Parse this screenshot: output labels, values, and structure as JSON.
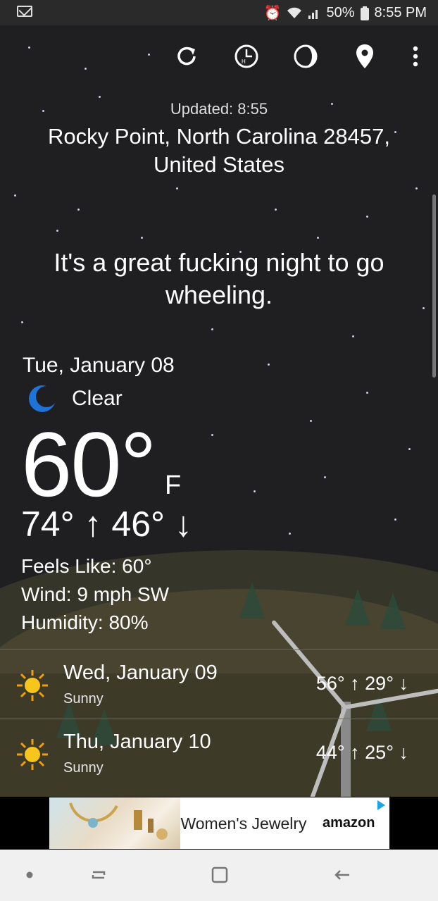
{
  "status_bar": {
    "battery": "50%",
    "time": "8:55 PM",
    "icons": [
      "mail-icon",
      "alarm-icon",
      "wifi-icon",
      "signal-icon",
      "battery-icon"
    ]
  },
  "toolbar": {
    "icons": [
      "refresh-icon",
      "hourly-icon",
      "moon-phase-icon",
      "location-pin-icon",
      "more-vert-icon"
    ]
  },
  "header": {
    "updated": "Updated: 8:55",
    "location": "Rocky Point, North Carolina 28457, United States"
  },
  "quote": "It's a great fucking night to go wheeling.",
  "current": {
    "date": "Tue, January 08",
    "condition": "Clear",
    "condition_icon": "moon-icon",
    "temperature": "60°",
    "unit": "F",
    "hilo": "74° ↑ 46° ↓",
    "feels_like": "Feels Like: 60°",
    "wind": "Wind: 9 mph SW",
    "humidity": "Humidity: 80%"
  },
  "forecast": [
    {
      "date": "Wed, January 09",
      "condition": "Sunny",
      "range": "56° ↑ 29° ↓",
      "icon": "sun-icon"
    },
    {
      "date": "Thu, January 10",
      "condition": "Sunny",
      "range": "44° ↑ 25° ↓",
      "icon": "sun-icon"
    }
  ],
  "ad": {
    "text": "Women's Jewelry",
    "brand": "amazon"
  },
  "colors": {
    "sky": "#1f1f21",
    "moon_blue": "#1e73d8",
    "sun_yellow": "#f7c51b",
    "sun_orange": "#f39c12",
    "ad_play": "#1aa3e8"
  },
  "navbar": {
    "items": [
      "recent-dot",
      "recents-button",
      "home-button",
      "back-button"
    ]
  }
}
